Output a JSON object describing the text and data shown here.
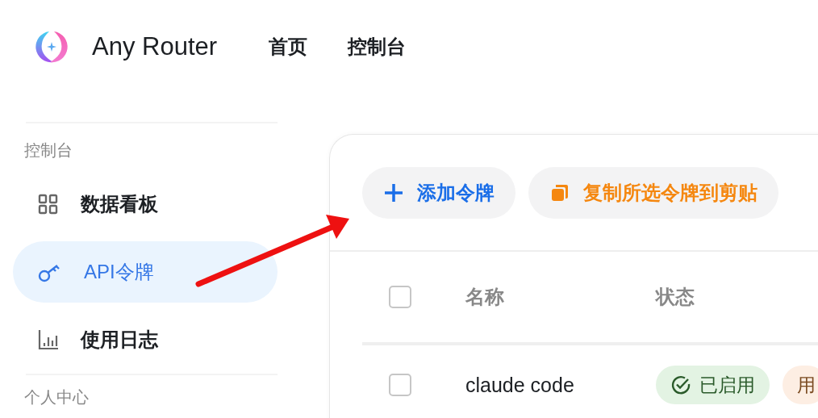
{
  "header": {
    "brand": "Any Router",
    "nav": [
      {
        "label": "首页",
        "selected": false
      },
      {
        "label": "控制台",
        "selected": false
      }
    ]
  },
  "sidebar": {
    "sections": [
      {
        "title": "控制台",
        "items": [
          {
            "label": "数据看板",
            "selected": false
          },
          {
            "label": "API令牌",
            "selected": true
          },
          {
            "label": "使用日志",
            "selected": false
          }
        ]
      },
      {
        "title": "个人中心"
      }
    ]
  },
  "toolbar": {
    "buttons": [
      {
        "label": "添加令牌",
        "kind": "add"
      },
      {
        "label": "复制所选令牌到剪贴",
        "kind": "copy"
      }
    ]
  },
  "table": {
    "select_all": {
      "checked": false
    },
    "columns": [
      "名称",
      "状态"
    ],
    "rows": [
      {
        "checked": false,
        "name": "claude code",
        "tags": [
          {
            "label": "已启用",
            "kind": "status",
            "color": "#e3f3e3"
          },
          {
            "label": "用",
            "kind": "plain",
            "color": "#fdeee3"
          }
        ]
      }
    ]
  }
}
